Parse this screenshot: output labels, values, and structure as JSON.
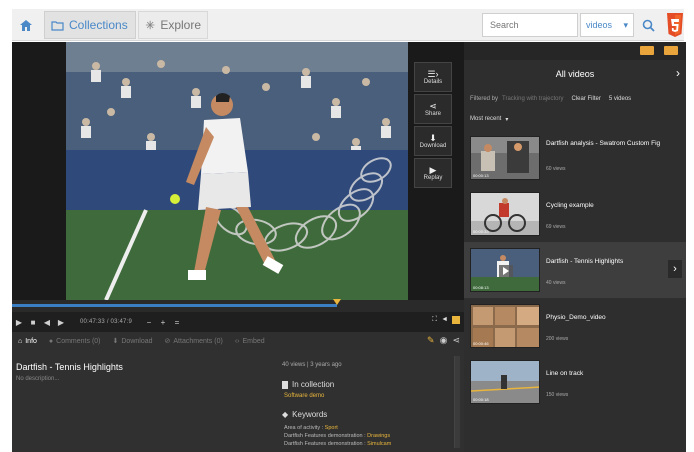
{
  "nav": {
    "collections_label": "Collections",
    "explore_label": "Explore",
    "search_placeholder": "Search",
    "scope_value": "videos"
  },
  "player": {
    "side_actions": {
      "details": "Details",
      "share": "Share",
      "download": "Download",
      "replay": "Replay"
    },
    "timecode": "00:47:33 / 03:47:9",
    "progress": 0.72
  },
  "tabs": {
    "info": "Info",
    "comments": "Comments (0)",
    "download": "Download",
    "attachments": "Attachments (0)",
    "embed": "Embed"
  },
  "info": {
    "title": "Dartfish - Tennis Highlights",
    "description": "No description...",
    "meta": "40 views | 3 years ago",
    "in_collection_label": "In collection",
    "collection_name": "Software demo",
    "keywords_label": "Keywords",
    "keywords": [
      {
        "key": "Area of activity : ",
        "value": "Sport"
      },
      {
        "key": "Dartfish Features demonstration : ",
        "value": "Drawings"
      },
      {
        "key": "Dartfish Features demonstration : ",
        "value": "Simulcam"
      }
    ]
  },
  "sidebar": {
    "title": "All videos",
    "filtered_by_label": "Filtered by",
    "filter_value": "Tracking with trajectory",
    "clear_filter": "Clear Filter",
    "count": "5 videos",
    "sort_value": "Most recent",
    "videos": [
      {
        "title": "Dartfish analysis - Swatrom Custom Fig",
        "views": "60 views",
        "time": "00:00:13"
      },
      {
        "title": "Cycling example",
        "views": "69 views",
        "time": "00:00:33"
      },
      {
        "title": "Dartfish - Tennis Highlights",
        "views": "40 views",
        "time": "00:08:13"
      },
      {
        "title": "Physio_Demo_video",
        "views": "200 views",
        "time": "00:00:46"
      },
      {
        "title": "Line on track",
        "views": "150 views",
        "time": "00:00:18"
      }
    ]
  },
  "colors": {
    "accent": "#e9b53c",
    "link": "#4a88c8",
    "panel": "#303030"
  }
}
